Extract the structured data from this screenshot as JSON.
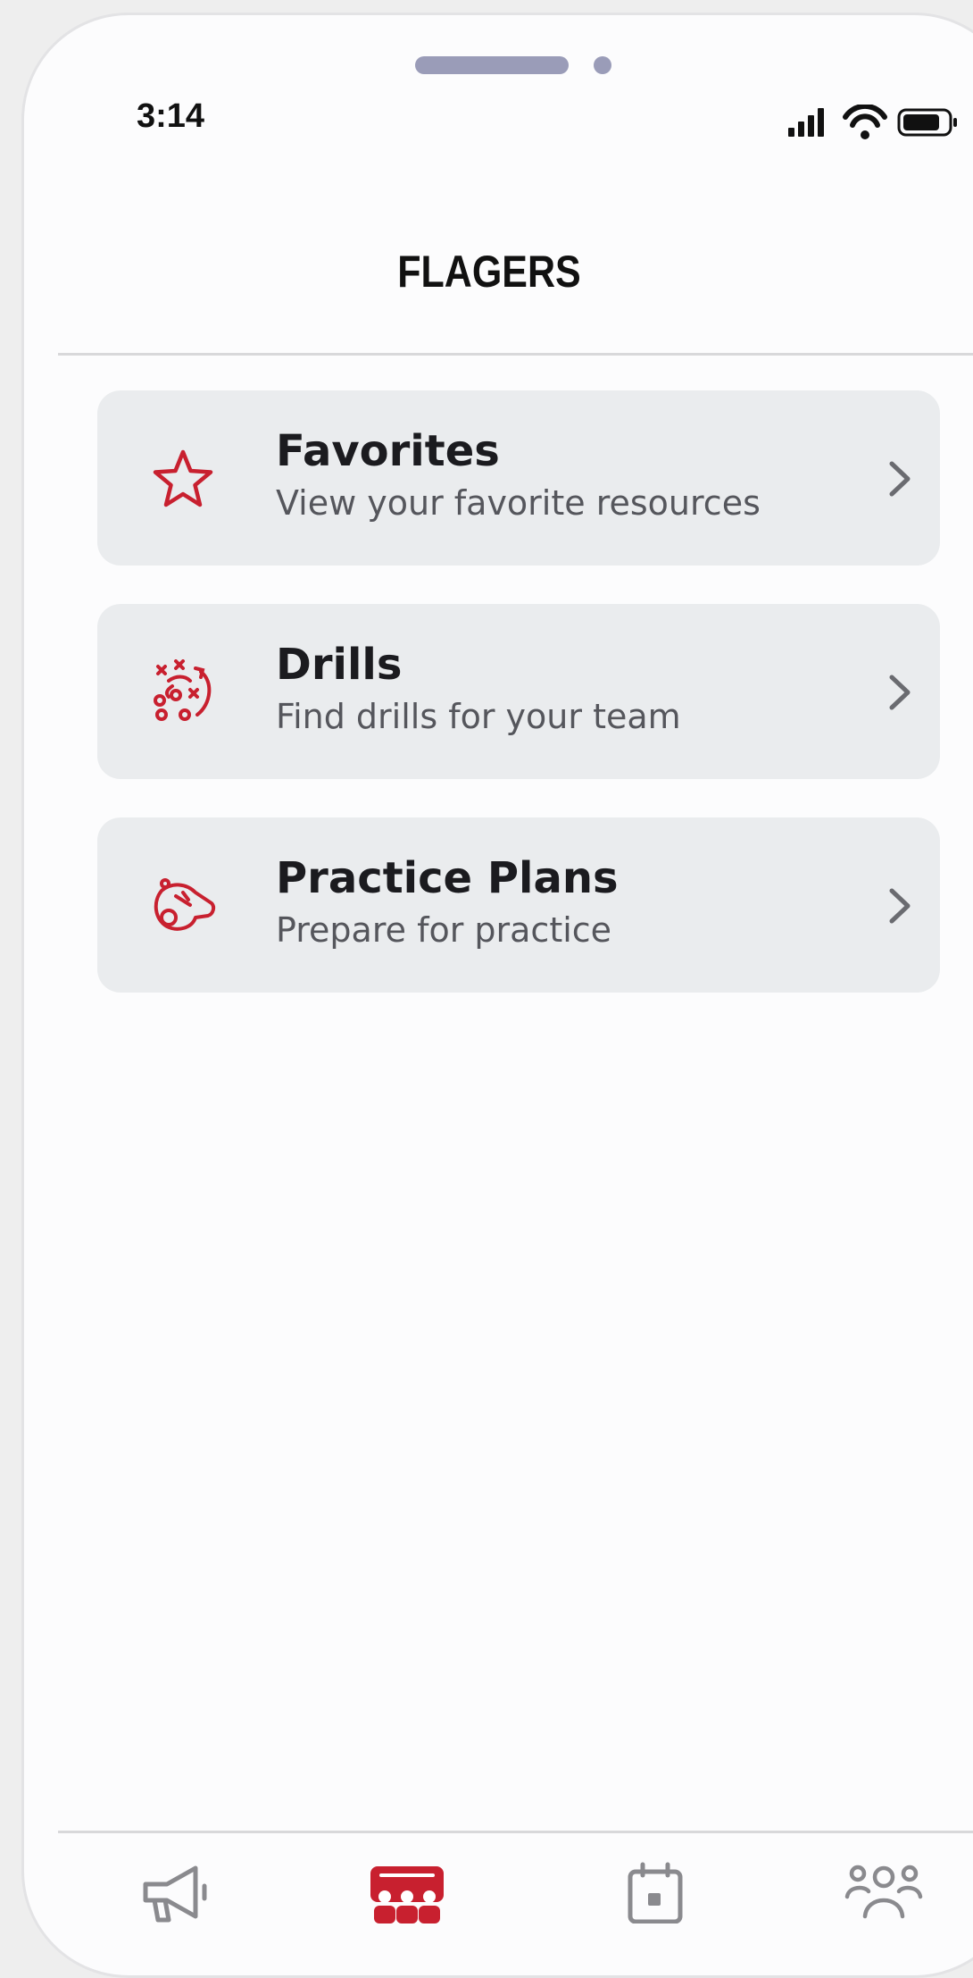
{
  "status_bar": {
    "time": "3:14",
    "icons": [
      "signal-icon",
      "wifi-icon",
      "battery-icon"
    ]
  },
  "header": {
    "title": "FLAGERS"
  },
  "menu": {
    "items": [
      {
        "title": "Favorites",
        "subtitle": "View your favorite resources",
        "icon": "star-icon"
      },
      {
        "title": "Drills",
        "subtitle": "Find drills for your team",
        "icon": "playbook-icon"
      },
      {
        "title": "Practice Plans",
        "subtitle": "Prepare for practice",
        "icon": "whistle-icon"
      }
    ]
  },
  "tab_bar": {
    "items": [
      {
        "icon": "megaphone-icon",
        "active": false
      },
      {
        "icon": "team-icon",
        "active": true
      },
      {
        "icon": "calendar-icon",
        "active": false
      },
      {
        "icon": "people-icon",
        "active": false
      }
    ]
  },
  "colors": {
    "accent": "#c8202f",
    "card_background": "#eaecee",
    "title_text": "#1b1b1f",
    "subtitle_text": "#55565c",
    "inactive_icon": "#8a8a8e"
  }
}
